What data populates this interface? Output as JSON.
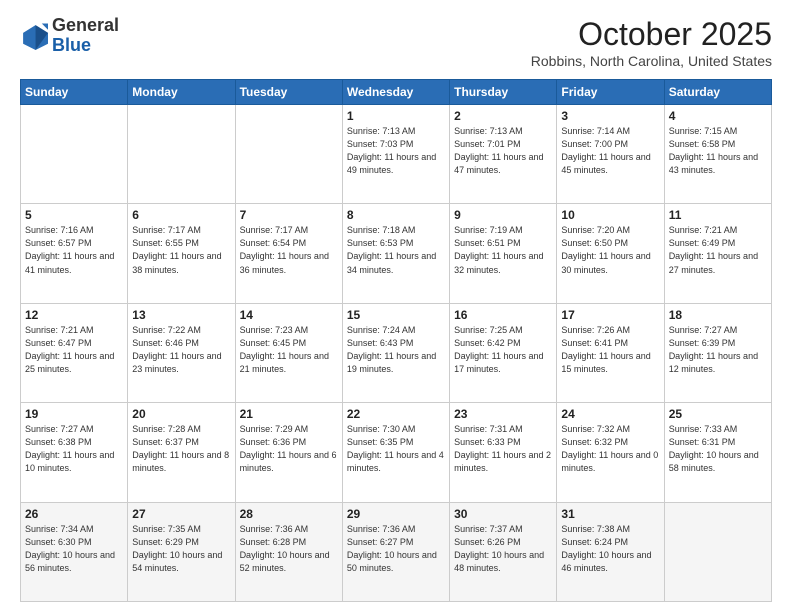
{
  "logo": {
    "general": "General",
    "blue": "Blue"
  },
  "header": {
    "month": "October 2025",
    "location": "Robbins, North Carolina, United States"
  },
  "weekdays": [
    "Sunday",
    "Monday",
    "Tuesday",
    "Wednesday",
    "Thursday",
    "Friday",
    "Saturday"
  ],
  "weeks": [
    [
      {
        "day": "",
        "info": ""
      },
      {
        "day": "",
        "info": ""
      },
      {
        "day": "",
        "info": ""
      },
      {
        "day": "1",
        "info": "Sunrise: 7:13 AM\nSunset: 7:03 PM\nDaylight: 11 hours\nand 49 minutes."
      },
      {
        "day": "2",
        "info": "Sunrise: 7:13 AM\nSunset: 7:01 PM\nDaylight: 11 hours\nand 47 minutes."
      },
      {
        "day": "3",
        "info": "Sunrise: 7:14 AM\nSunset: 7:00 PM\nDaylight: 11 hours\nand 45 minutes."
      },
      {
        "day": "4",
        "info": "Sunrise: 7:15 AM\nSunset: 6:58 PM\nDaylight: 11 hours\nand 43 minutes."
      }
    ],
    [
      {
        "day": "5",
        "info": "Sunrise: 7:16 AM\nSunset: 6:57 PM\nDaylight: 11 hours\nand 41 minutes."
      },
      {
        "day": "6",
        "info": "Sunrise: 7:17 AM\nSunset: 6:55 PM\nDaylight: 11 hours\nand 38 minutes."
      },
      {
        "day": "7",
        "info": "Sunrise: 7:17 AM\nSunset: 6:54 PM\nDaylight: 11 hours\nand 36 minutes."
      },
      {
        "day": "8",
        "info": "Sunrise: 7:18 AM\nSunset: 6:53 PM\nDaylight: 11 hours\nand 34 minutes."
      },
      {
        "day": "9",
        "info": "Sunrise: 7:19 AM\nSunset: 6:51 PM\nDaylight: 11 hours\nand 32 minutes."
      },
      {
        "day": "10",
        "info": "Sunrise: 7:20 AM\nSunset: 6:50 PM\nDaylight: 11 hours\nand 30 minutes."
      },
      {
        "day": "11",
        "info": "Sunrise: 7:21 AM\nSunset: 6:49 PM\nDaylight: 11 hours\nand 27 minutes."
      }
    ],
    [
      {
        "day": "12",
        "info": "Sunrise: 7:21 AM\nSunset: 6:47 PM\nDaylight: 11 hours\nand 25 minutes."
      },
      {
        "day": "13",
        "info": "Sunrise: 7:22 AM\nSunset: 6:46 PM\nDaylight: 11 hours\nand 23 minutes."
      },
      {
        "day": "14",
        "info": "Sunrise: 7:23 AM\nSunset: 6:45 PM\nDaylight: 11 hours\nand 21 minutes."
      },
      {
        "day": "15",
        "info": "Sunrise: 7:24 AM\nSunset: 6:43 PM\nDaylight: 11 hours\nand 19 minutes."
      },
      {
        "day": "16",
        "info": "Sunrise: 7:25 AM\nSunset: 6:42 PM\nDaylight: 11 hours\nand 17 minutes."
      },
      {
        "day": "17",
        "info": "Sunrise: 7:26 AM\nSunset: 6:41 PM\nDaylight: 11 hours\nand 15 minutes."
      },
      {
        "day": "18",
        "info": "Sunrise: 7:27 AM\nSunset: 6:39 PM\nDaylight: 11 hours\nand 12 minutes."
      }
    ],
    [
      {
        "day": "19",
        "info": "Sunrise: 7:27 AM\nSunset: 6:38 PM\nDaylight: 11 hours\nand 10 minutes."
      },
      {
        "day": "20",
        "info": "Sunrise: 7:28 AM\nSunset: 6:37 PM\nDaylight: 11 hours\nand 8 minutes."
      },
      {
        "day": "21",
        "info": "Sunrise: 7:29 AM\nSunset: 6:36 PM\nDaylight: 11 hours\nand 6 minutes."
      },
      {
        "day": "22",
        "info": "Sunrise: 7:30 AM\nSunset: 6:35 PM\nDaylight: 11 hours\nand 4 minutes."
      },
      {
        "day": "23",
        "info": "Sunrise: 7:31 AM\nSunset: 6:33 PM\nDaylight: 11 hours\nand 2 minutes."
      },
      {
        "day": "24",
        "info": "Sunrise: 7:32 AM\nSunset: 6:32 PM\nDaylight: 11 hours\nand 0 minutes."
      },
      {
        "day": "25",
        "info": "Sunrise: 7:33 AM\nSunset: 6:31 PM\nDaylight: 10 hours\nand 58 minutes."
      }
    ],
    [
      {
        "day": "26",
        "info": "Sunrise: 7:34 AM\nSunset: 6:30 PM\nDaylight: 10 hours\nand 56 minutes."
      },
      {
        "day": "27",
        "info": "Sunrise: 7:35 AM\nSunset: 6:29 PM\nDaylight: 10 hours\nand 54 minutes."
      },
      {
        "day": "28",
        "info": "Sunrise: 7:36 AM\nSunset: 6:28 PM\nDaylight: 10 hours\nand 52 minutes."
      },
      {
        "day": "29",
        "info": "Sunrise: 7:36 AM\nSunset: 6:27 PM\nDaylight: 10 hours\nand 50 minutes."
      },
      {
        "day": "30",
        "info": "Sunrise: 7:37 AM\nSunset: 6:26 PM\nDaylight: 10 hours\nand 48 minutes."
      },
      {
        "day": "31",
        "info": "Sunrise: 7:38 AM\nSunset: 6:24 PM\nDaylight: 10 hours\nand 46 minutes."
      },
      {
        "day": "",
        "info": ""
      }
    ]
  ]
}
